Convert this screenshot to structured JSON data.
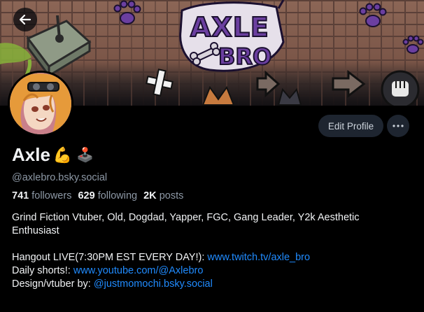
{
  "profile": {
    "display_name": "Axle",
    "name_emoji_1": "💪",
    "name_emoji_2": "🕹️",
    "handle": "@axlebro.bsky.social",
    "banner_logo": "AXLE BRO"
  },
  "actions": {
    "edit_label": "Edit Profile",
    "more_icon": "ellipsis-icon",
    "back_icon": "arrow-left-icon"
  },
  "stats": {
    "followers_count": "741",
    "followers_label": "followers",
    "following_count": "629",
    "following_label": "following",
    "posts_count": "2K",
    "posts_label": "posts"
  },
  "bio": {
    "line1": "Grind Fiction Vtuber, Old, Dogdad,  Yapper, FGC, Gang Leader, Y2k  Aesthetic",
    "line2": "Enthusiast",
    "hangout_text": "Hangout LIVE(7:30PM EST EVERY DAY!): ",
    "hangout_link": "www.twitch.tv/axle_bro",
    "shorts_text": "Daily shorts!: ",
    "shorts_link": "www.youtube.com/@Axlebro",
    "design_text": "Design/vtuber by: ",
    "design_link": "@justmomochi.bsky.social"
  },
  "colors": {
    "background": "#000000",
    "text": "#f1f3f5",
    "muted": "#8d98a5",
    "link": "#208bfe",
    "button_bg": "#1e2530",
    "graffiti_purple": "#6b3fa0"
  }
}
